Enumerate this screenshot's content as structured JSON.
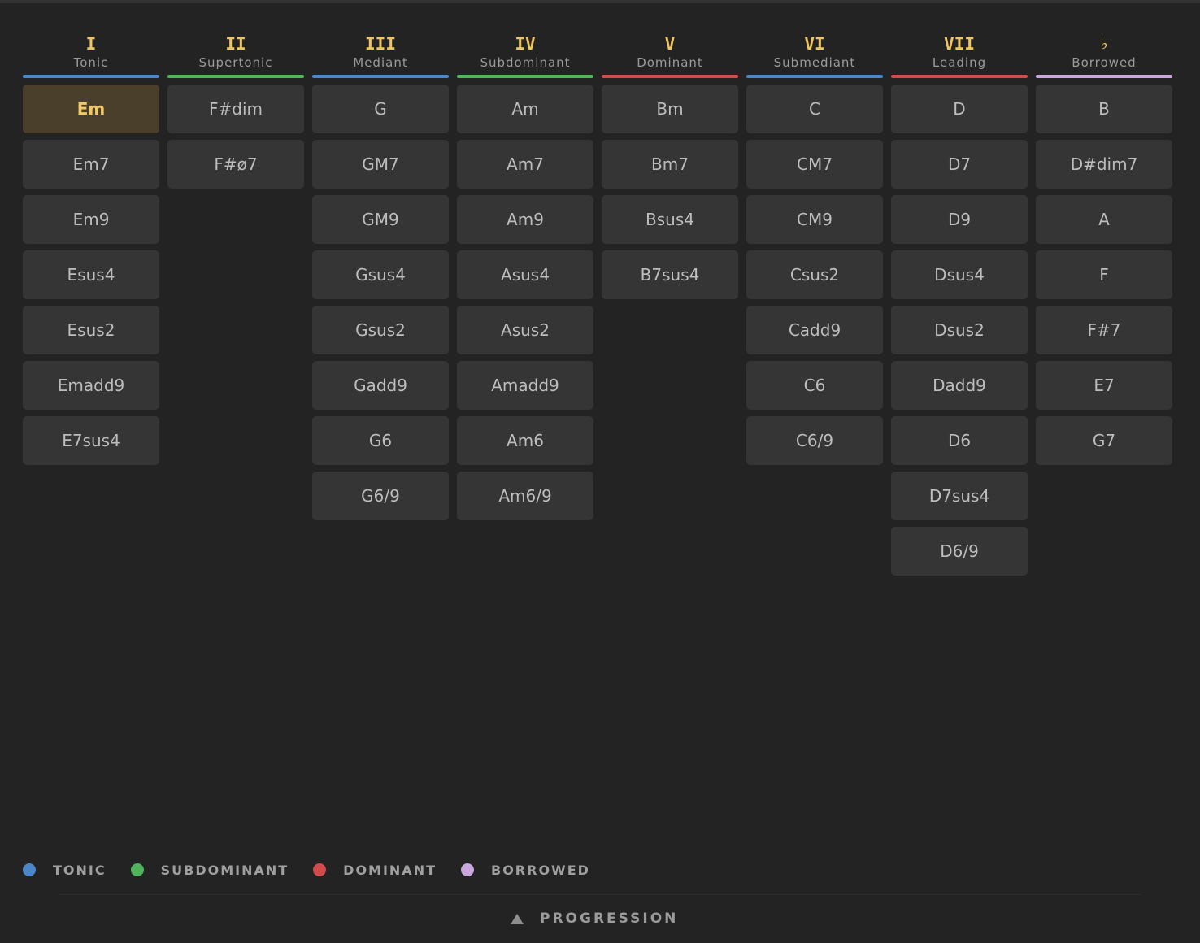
{
  "columns": [
    {
      "roman": "I",
      "function": "Tonic",
      "color": "#4a86c8",
      "chords": [
        "Em",
        "Em7",
        "Em9",
        "Esus4",
        "Esus2",
        "Emadd9",
        "E7sus4"
      ],
      "selected": 0
    },
    {
      "roman": "II",
      "function": "Supertonic",
      "color": "#4fb45a",
      "chords": [
        "F#dim",
        "F#ø7"
      ]
    },
    {
      "roman": "III",
      "function": "Mediant",
      "color": "#4a86c8",
      "chords": [
        "G",
        "GM7",
        "GM9",
        "Gsus4",
        "Gsus2",
        "Gadd9",
        "G6",
        "G6/9"
      ]
    },
    {
      "roman": "IV",
      "function": "Subdominant",
      "color": "#4fb45a",
      "chords": [
        "Am",
        "Am7",
        "Am9",
        "Asus4",
        "Asus2",
        "Amadd9",
        "Am6",
        "Am6/9"
      ]
    },
    {
      "roman": "V",
      "function": "Dominant",
      "color": "#d24b4b",
      "chords": [
        "Bm",
        "Bm7",
        "Bsus4",
        "B7sus4"
      ]
    },
    {
      "roman": "VI",
      "function": "Submediant",
      "color": "#4a86c8",
      "chords": [
        "C",
        "CM7",
        "CM9",
        "Csus2",
        "Cadd9",
        "C6",
        "C6/9"
      ]
    },
    {
      "roman": "VII",
      "function": "Leading",
      "color": "#d24b4b",
      "chords": [
        "D",
        "D7",
        "D9",
        "Dsus4",
        "Dsus2",
        "Dadd9",
        "D6",
        "D7sus4",
        "D6/9"
      ]
    },
    {
      "roman": "♭",
      "function": "Borrowed",
      "color": "#c9a6dc",
      "chords": [
        "B",
        "D#dim7",
        "A",
        "F",
        "F#7",
        "E7",
        "G7"
      ]
    }
  ],
  "legend": [
    {
      "label": "TONIC",
      "color": "#4a86c8"
    },
    {
      "label": "SUBDOMINANT",
      "color": "#4fb45a"
    },
    {
      "label": "DOMINANT",
      "color": "#d24b4b"
    },
    {
      "label": "BORROWED",
      "color": "#c9a6dc"
    }
  ],
  "progression": {
    "label": "PROGRESSION",
    "icon": "triangle-up-icon"
  }
}
